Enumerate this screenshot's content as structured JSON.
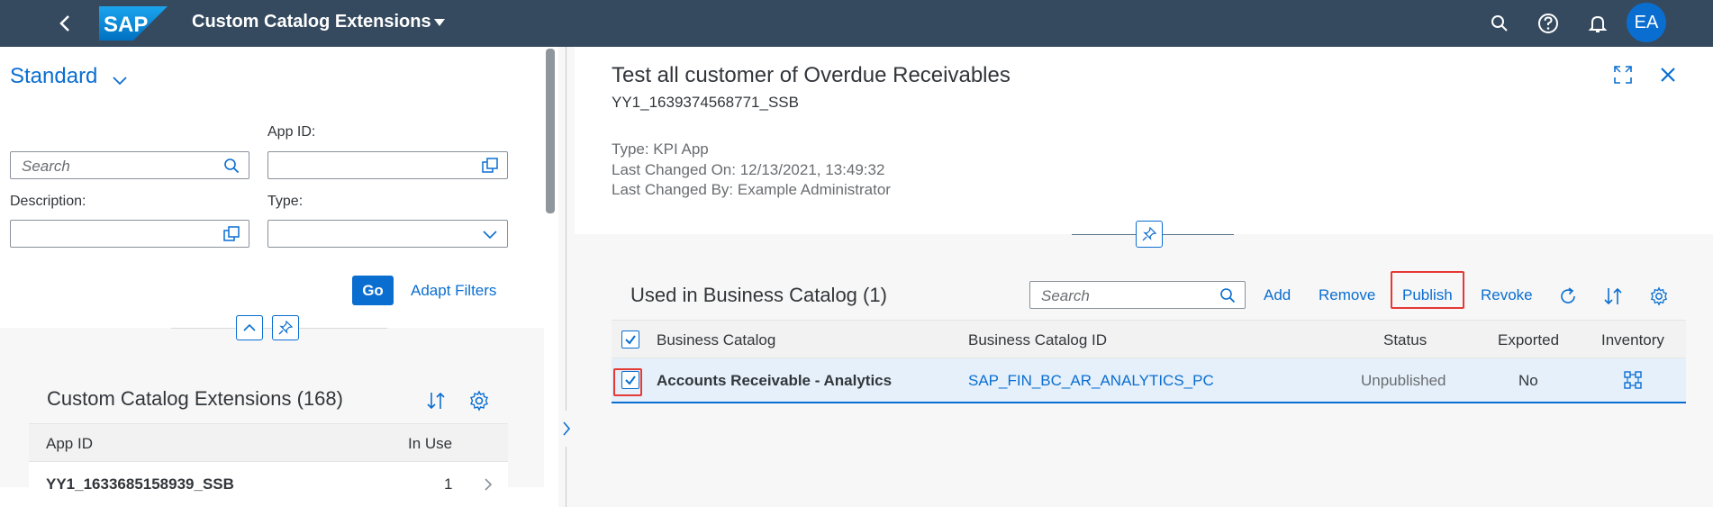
{
  "shell": {
    "app_title": "Custom Catalog Extensions",
    "logo_text": "SAP",
    "avatar_initials": "EA"
  },
  "filterbar": {
    "variant": "Standard",
    "search_placeholder": "Search",
    "app_id_label": "App ID:",
    "description_label": "Description:",
    "type_label": "Type:",
    "go_label": "Go",
    "adapt_filters_label": "Adapt Filters"
  },
  "list": {
    "title": "Custom Catalog Extensions (168)",
    "columns": [
      "App ID",
      "In Use"
    ],
    "rows": [
      {
        "app_id": "YY1_1633685158939_SSB",
        "in_use": "1"
      }
    ]
  },
  "detail": {
    "title": "Test all customer of Overdue Receivables",
    "subtitle": "YY1_1639374568771_SSB",
    "type": "Type: KPI App",
    "last_changed_on": "Last Changed On: 12/13/2021, 13:49:32",
    "last_changed_by": "Last Changed By: Example Administrator"
  },
  "catalog_table": {
    "title": "Used in Business Catalog (1)",
    "search_placeholder": "Search",
    "actions": {
      "add": "Add",
      "remove": "Remove",
      "publish": "Publish",
      "revoke": "Revoke"
    },
    "columns": {
      "name": "Business Catalog",
      "id": "Business Catalog ID",
      "status": "Status",
      "exported": "Exported",
      "inventory": "Inventory"
    },
    "rows": [
      {
        "name": "Accounts Receivable - Analytics",
        "id": "SAP_FIN_BC_AR_ANALYTICS_PC",
        "status": "Unpublished",
        "exported": "No",
        "selected": true
      }
    ]
  },
  "colors": {
    "shell": "#354a5f",
    "brand": "#0a6ed1",
    "highlight_box": "#e53935",
    "selected_row": "#e5f0fa"
  },
  "icons": [
    "back-icon",
    "sap-logo",
    "dropdown-caret-icon",
    "search-icon",
    "help-icon",
    "bell-icon",
    "value-help-icon",
    "chevron-down-icon",
    "collapse-icon",
    "pin-icon",
    "sort-icon",
    "settings-icon",
    "nav-arrow-icon",
    "expand-panel-icon",
    "fullscreen-icon",
    "close-icon",
    "refresh-icon",
    "checkbox-icon",
    "inventory-icon"
  ]
}
